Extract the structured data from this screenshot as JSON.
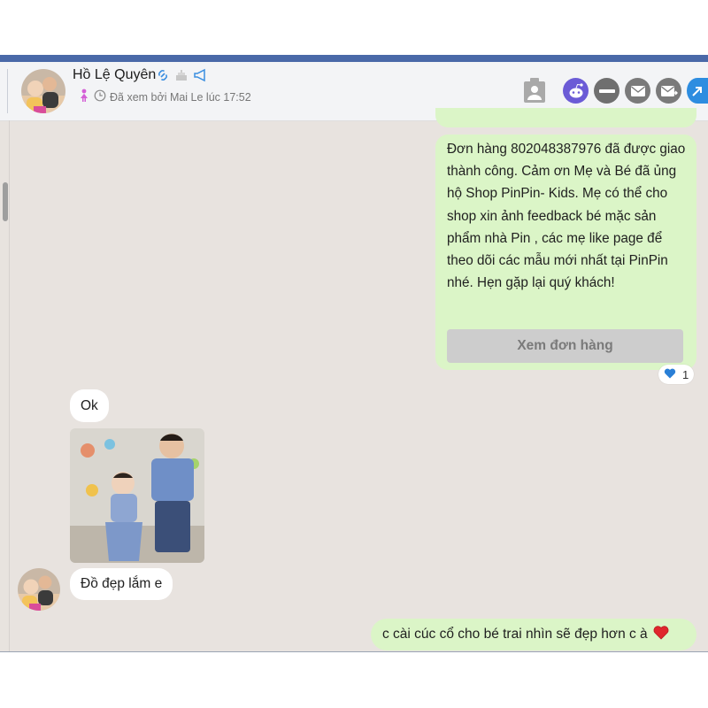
{
  "contact": {
    "name": "Hồ Lệ Quyên",
    "seen_status": "Đã xem bởi Mai Le lúc 17:52"
  },
  "header_icons": [
    "link-icon",
    "cake-icon",
    "megaphone-icon",
    "contact-card-icon",
    "reddit-icon",
    "minus-icon",
    "mail-icon",
    "mail-forward-icon",
    "share-arrow-icon"
  ],
  "messages": {
    "order_message": "Đơn hàng 802048387976 đã được giao thành công. Cảm ơn Mẹ và Bé đã ủng hộ Shop PinPin- Kids. Mẹ có thể cho shop xin ảnh feedback bé mặc sản phẩm nhà Pin , các mẹ like page để theo dõi các mẫu mới nhất tại PinPin nhé. Hẹn gặp lại quý khách!",
    "view_order_button": "Xem đơn hàng",
    "reaction_count": "1",
    "reply_ok": "Ok",
    "reply_compliment": "Đồ đẹp lắm e",
    "shop_reply": "c cài cúc cổ cho bé trai nhìn sẽ đẹp hơn c à"
  },
  "colors": {
    "outgoing_bubble": "#dbf5c7",
    "incoming_bubble": "#ffffff",
    "chat_background": "#e8e3df",
    "top_accent": "#4a69a8",
    "reaction_heart": "#2a7fd6",
    "emoji_heart": "#e0262d"
  }
}
